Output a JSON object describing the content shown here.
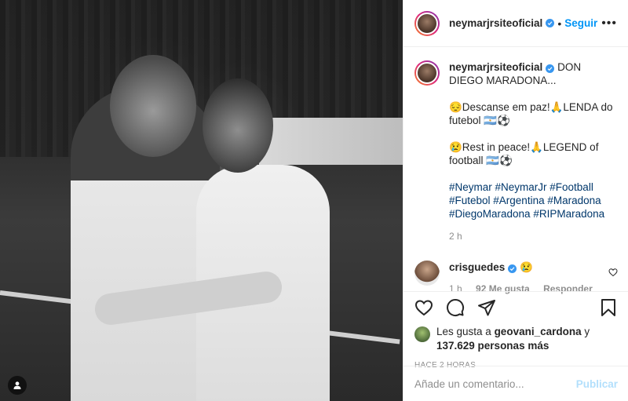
{
  "post": {
    "username": "neymarjrsiteoficial",
    "follow_label": "Seguir",
    "more_label": "•••",
    "separator": "•"
  },
  "caption": {
    "username": "neymarjrsiteoficial",
    "line1": "DON DIEGO MARADONA...",
    "pt": "😔Descanse em paz!🙏LENDA do futebol 🇦🇷⚽",
    "en": "😢Rest in peace!🙏LEGEND of football 🇦🇷⚽",
    "hashtags": "#Neymar #NeymarJr #Football #Futebol #Argentina #Maradona #DiegoMaradona #RIPMaradona",
    "time": "2 h"
  },
  "comments": [
    {
      "username": "crisguedes",
      "text": "😢",
      "time": "1 h",
      "likes": "92 Me gusta",
      "reply_label": "Responder"
    }
  ],
  "likes": {
    "prefix": "Les gusta a ",
    "user": "geovani_cardona",
    "conj": " y",
    "others": "137.629 personas más"
  },
  "timestamp": "HACE 2 HORAS",
  "add_comment": {
    "placeholder": "Añade un comentario...",
    "post_label": "Publicar"
  },
  "icons": {
    "verified": "verified-badge-icon",
    "heart": "heart-icon",
    "comment": "comment-icon",
    "share": "share-icon",
    "bookmark": "bookmark-icon",
    "user_tag": "user-tag-icon"
  },
  "colors": {
    "accent": "#0095f6",
    "verified": "#3897f0",
    "hashtag": "#00376b",
    "muted": "#8e8e8e"
  }
}
